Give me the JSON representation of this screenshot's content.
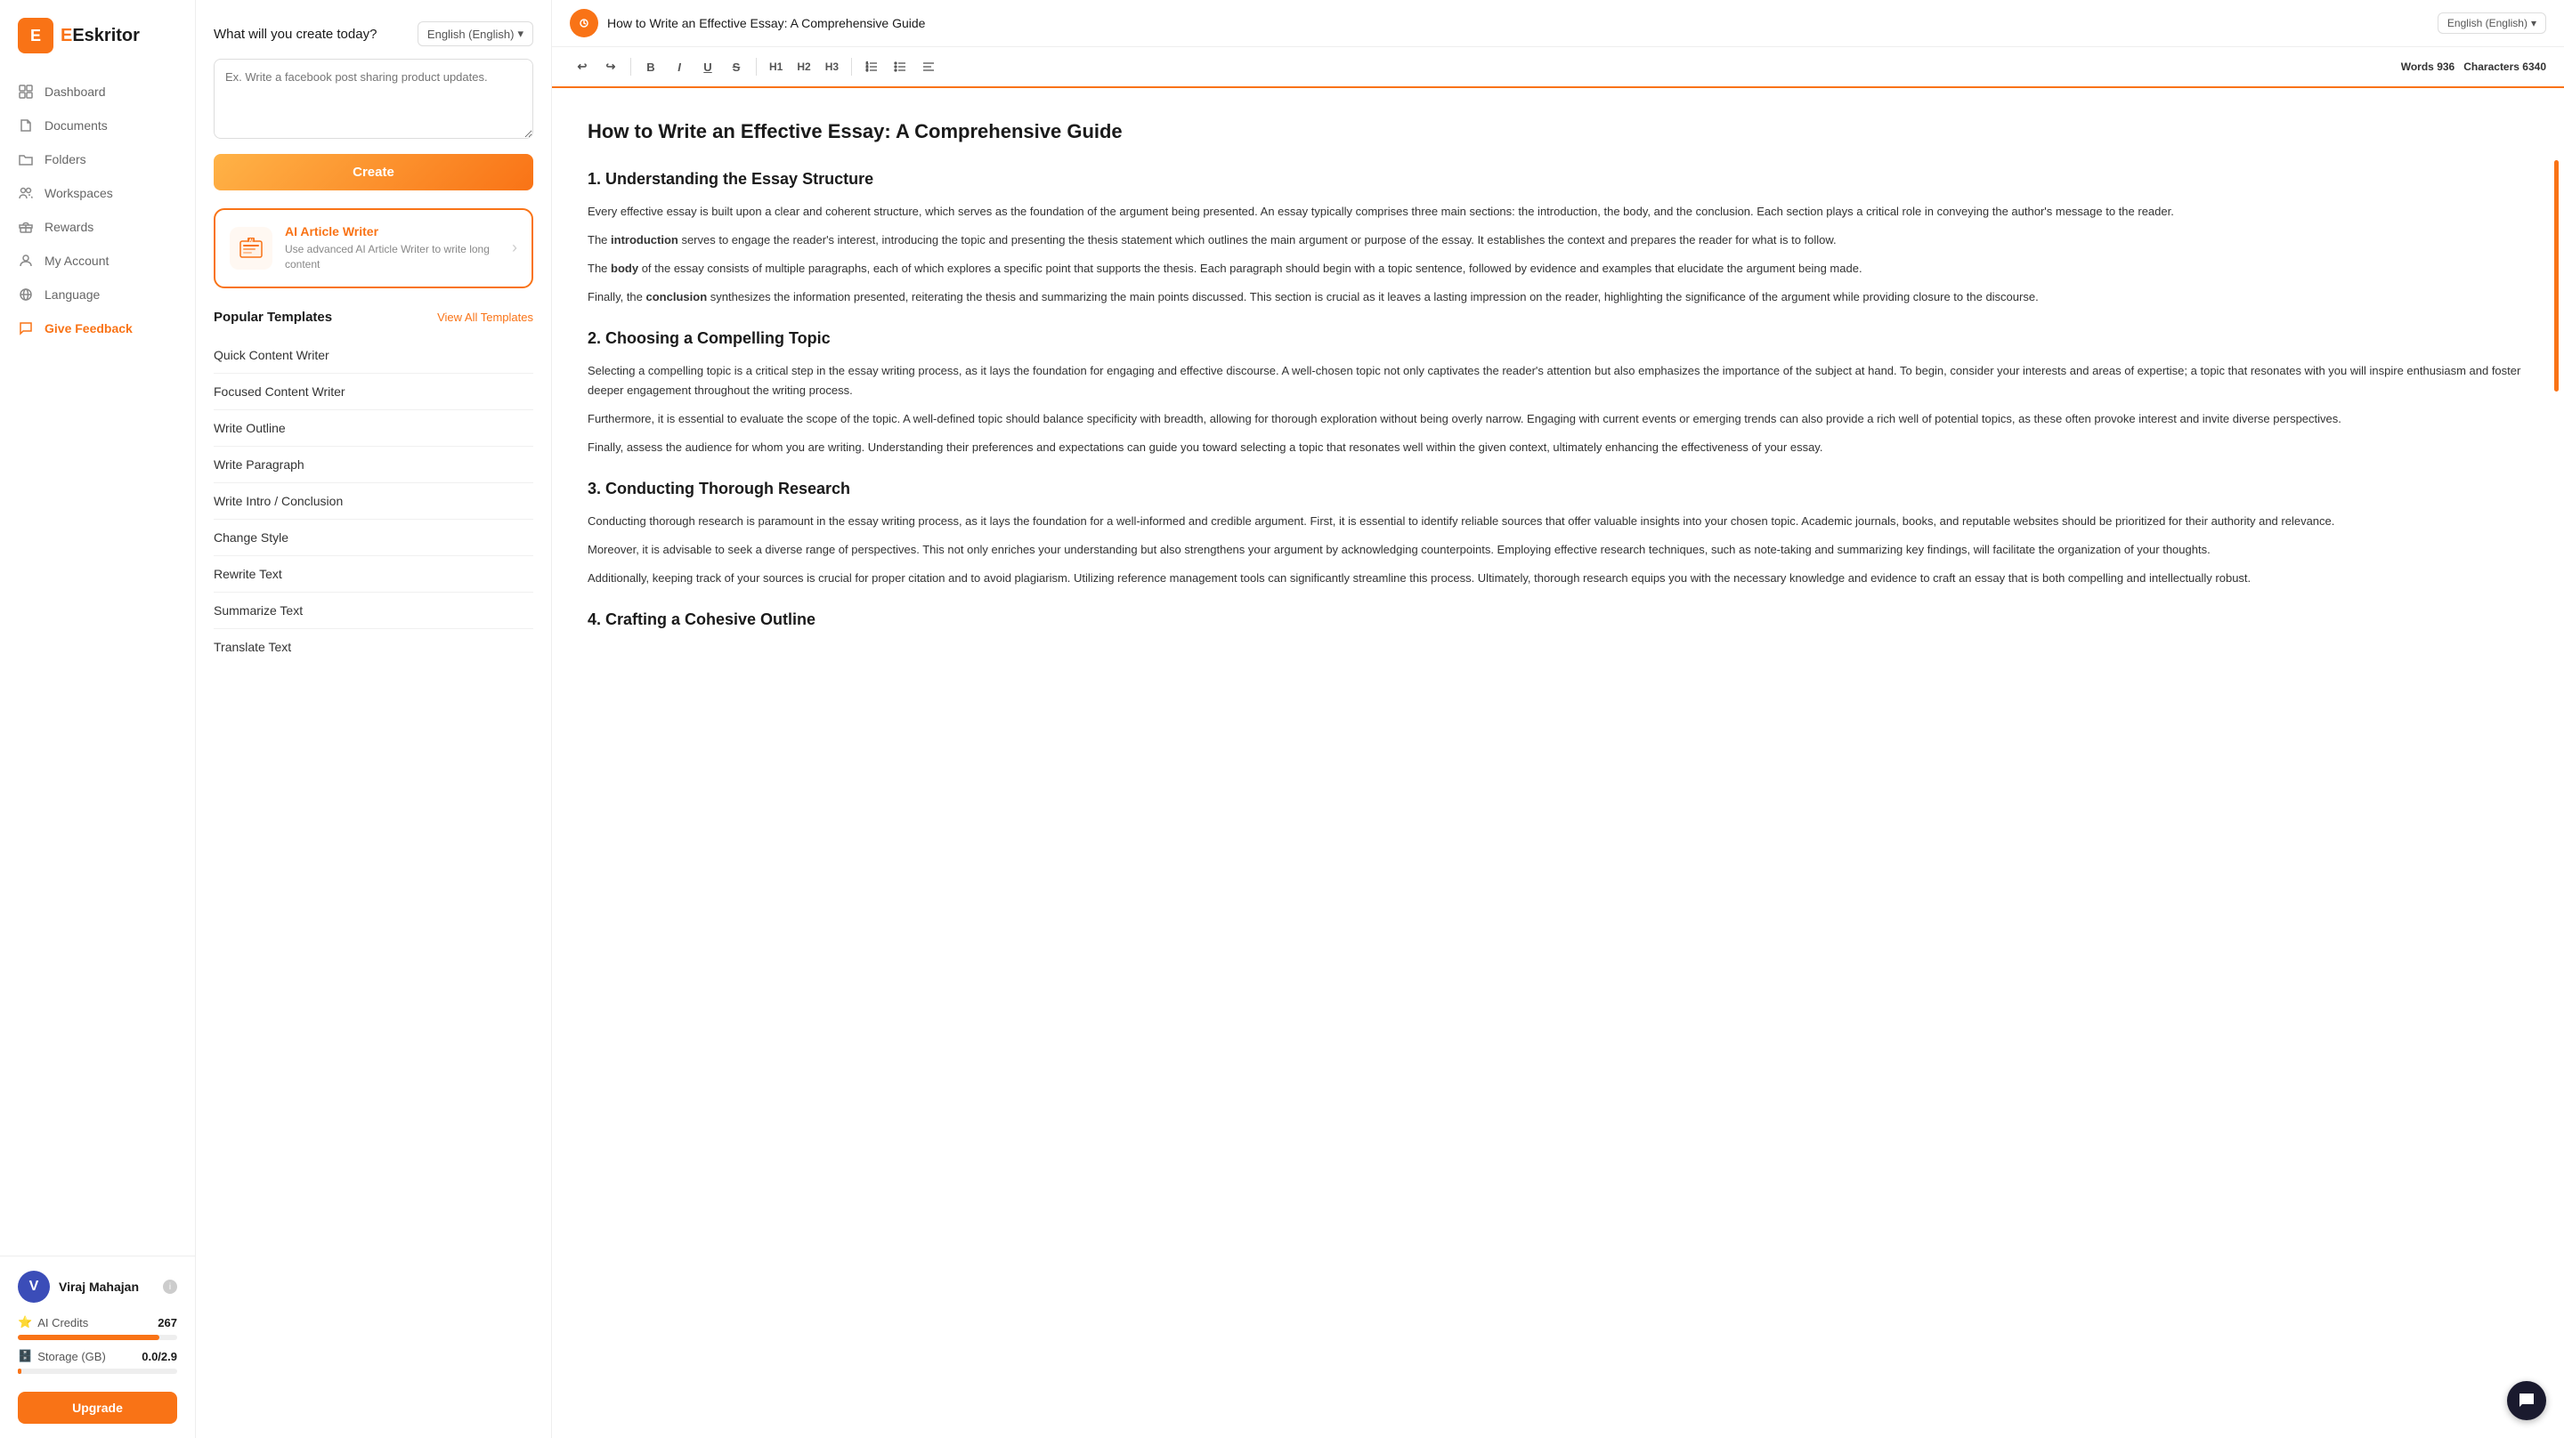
{
  "app": {
    "name": "Eskritor",
    "logo_letter": "E"
  },
  "sidebar": {
    "nav_items": [
      {
        "id": "dashboard",
        "label": "Dashboard",
        "icon": "grid"
      },
      {
        "id": "documents",
        "label": "Documents",
        "icon": "file"
      },
      {
        "id": "folders",
        "label": "Folders",
        "icon": "folder"
      },
      {
        "id": "workspaces",
        "label": "Workspaces",
        "icon": "users"
      },
      {
        "id": "rewards",
        "label": "Rewards",
        "icon": "gift"
      },
      {
        "id": "my-account",
        "label": "My Account",
        "icon": "user"
      },
      {
        "id": "language",
        "label": "Language",
        "icon": "globe"
      },
      {
        "id": "give-feedback",
        "label": "Give Feedback",
        "icon": "message"
      }
    ],
    "user": {
      "name": "Viraj Mahajan",
      "avatar_letter": "V",
      "avatar_color": "#3b4db8"
    },
    "credits": {
      "label": "AI Credits",
      "value": 267,
      "progress": 89
    },
    "storage": {
      "label": "Storage (GB)",
      "value": "0.0/2.9",
      "progress": 2
    },
    "upgrade_label": "Upgrade"
  },
  "middle": {
    "create_prompt_label": "What will you create today?",
    "language_selector": "English (English)",
    "textarea_placeholder": "Ex. Write a facebook post sharing product updates.",
    "create_button": "Create",
    "ai_card": {
      "title": "AI Article Writer",
      "description": "Use advanced AI Article Writer to write long content",
      "icon": "AI"
    },
    "popular_templates": {
      "title": "Popular Templates",
      "view_all": "View All Templates",
      "items": [
        "Quick Content Writer",
        "Focused Content Writer",
        "Write Outline",
        "Write Paragraph",
        "Write Intro / Conclusion",
        "Change Style",
        "Rewrite Text",
        "Summarize Text",
        "Translate Text"
      ]
    }
  },
  "editor": {
    "doc_title": "How to Write an Effective Essay: A Comprehensive Guide",
    "language": "English (English)",
    "words_label": "Words",
    "words_count": "936",
    "chars_label": "Characters",
    "chars_count": "6340",
    "toolbar": {
      "undo": "↩",
      "redo": "↪",
      "bold": "B",
      "italic": "I",
      "underline": "U",
      "strikethrough": "S",
      "h1": "H1",
      "h2": "H2",
      "h3": "H3",
      "ordered_list": "≡",
      "unordered_list": "≡",
      "align": "≡"
    },
    "content": {
      "title": "How to Write an Effective Essay: A Comprehensive Guide",
      "sections": [
        {
          "heading": "1. Understanding the Essay Structure",
          "paragraphs": [
            "Every effective essay is built upon a clear and coherent structure, which serves as the foundation of the argument being presented. An essay typically comprises three main sections: the introduction, the body, and the conclusion. Each section plays a critical role in conveying the author's message to the reader.",
            "The introduction serves to engage the reader's interest, introducing the topic and presenting the thesis statement which outlines the main argument or purpose of the essay. It establishes the context and prepares the reader for what is to follow.",
            "The body of the essay consists of multiple paragraphs, each of which explores a specific point that supports the thesis. Each paragraph should begin with a topic sentence, followed by evidence and examples that elucidate the argument being made.",
            "Finally, the conclusion synthesizes the information presented, reiterating the thesis and summarizing the main points discussed. This section is crucial as it leaves a lasting impression on the reader, highlighting the significance of the argument while providing closure to the discourse."
          ]
        },
        {
          "heading": "2. Choosing a Compelling Topic",
          "paragraphs": [
            "Selecting a compelling topic is a critical step in the essay writing process, as it lays the foundation for engaging and effective discourse. A well-chosen topic not only captivates the reader's attention but also emphasizes the importance of the subject at hand. To begin, consider your interests and areas of expertise; a topic that resonates with you will inspire enthusiasm and foster deeper engagement throughout the writing process.",
            "Furthermore, it is essential to evaluate the scope of the topic. A well-defined topic should balance specificity with breadth, allowing for thorough exploration without being overly narrow. Engaging with current events or emerging trends can also provide a rich well of potential topics, as these often provoke interest and invite diverse perspectives.",
            "Finally, assess the audience for whom you are writing. Understanding their preferences and expectations can guide you toward selecting a topic that resonates well within the given context, ultimately enhancing the effectiveness of your essay."
          ]
        },
        {
          "heading": "3. Conducting Thorough Research",
          "paragraphs": [
            "Conducting thorough research is paramount in the essay writing process, as it lays the foundation for a well-informed and credible argument. First, it is essential to identify reliable sources that offer valuable insights into your chosen topic. Academic journals, books, and reputable websites should be prioritized for their authority and relevance.",
            "Moreover, it is advisable to seek a diverse range of perspectives. This not only enriches your understanding but also strengthens your argument by acknowledging counterpoints. Employing effective research techniques, such as note-taking and summarizing key findings, will facilitate the organization of your thoughts.",
            "Additionally, keeping track of your sources is crucial for proper citation and to avoid plagiarism. Utilizing reference management tools can significantly streamline this process. Ultimately, thorough research equips you with the necessary knowledge and evidence to craft an essay that is both compelling and intellectually robust."
          ]
        },
        {
          "heading": "4. Crafting a Cohesive Outline",
          "paragraphs": []
        }
      ]
    }
  },
  "chat": {
    "icon": "💬"
  }
}
